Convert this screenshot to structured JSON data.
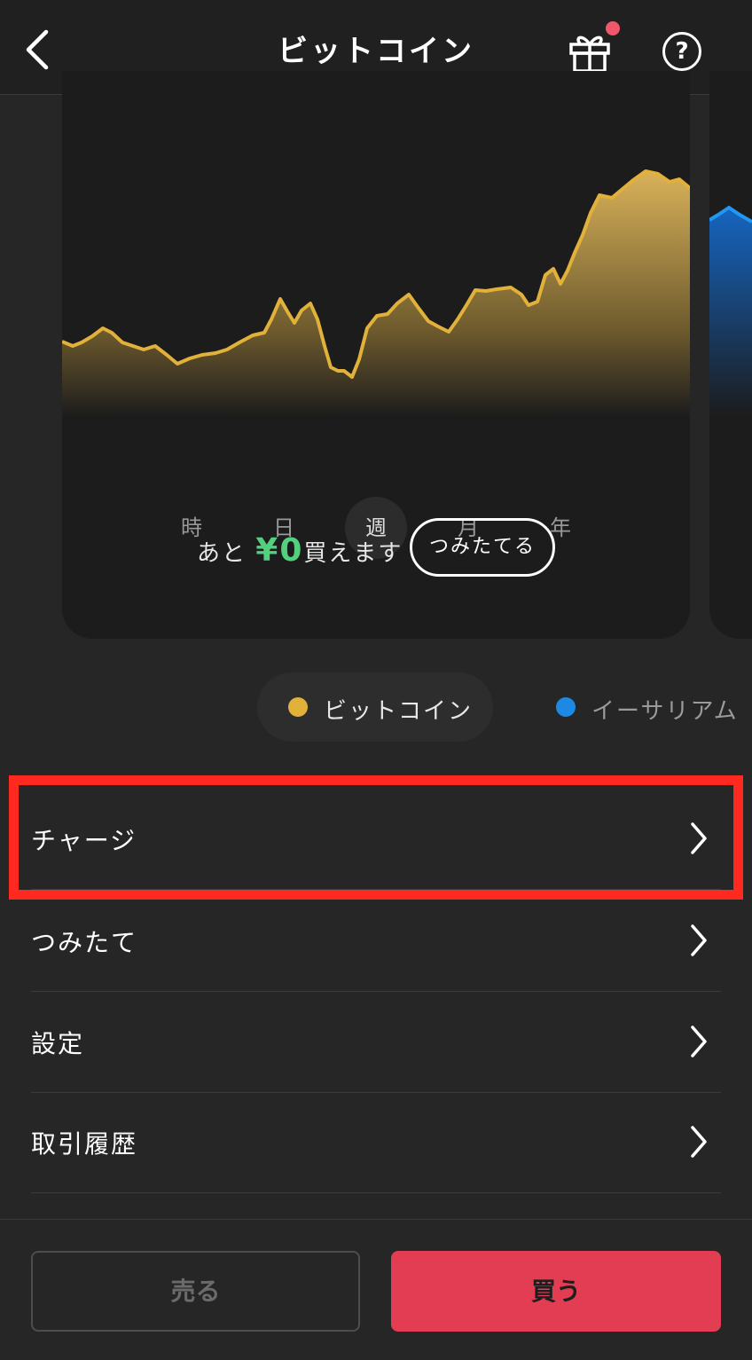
{
  "header": {
    "title": "ビットコイン",
    "back_icon": "chevron-left-icon",
    "gift_icon": "gift-icon",
    "help_icon": "question-circle-icon",
    "help_glyph": "?",
    "notification_color": "#f0576a"
  },
  "chart": {
    "line_color": "#e2b13a",
    "periods": [
      "時",
      "日",
      "週",
      "月",
      "年"
    ],
    "active_period": "週"
  },
  "purchase": {
    "prefix": "あと",
    "amount": "¥0",
    "suffix": "買えます",
    "button": "つみたてる"
  },
  "assets": [
    {
      "name": "ビットコイン",
      "color": "#e2b13a",
      "selected": true
    },
    {
      "name": "イーサリアム",
      "color": "#1e88e5",
      "selected": false
    }
  ],
  "menu": [
    {
      "label": "チャージ",
      "highlighted": true
    },
    {
      "label": "つみたて",
      "highlighted": false
    },
    {
      "label": "設定",
      "highlighted": false
    },
    {
      "label": "取引履歴",
      "highlighted": false
    }
  ],
  "footer": {
    "sell": "売る",
    "buy": "買う",
    "buy_color": "#e23d52"
  }
}
